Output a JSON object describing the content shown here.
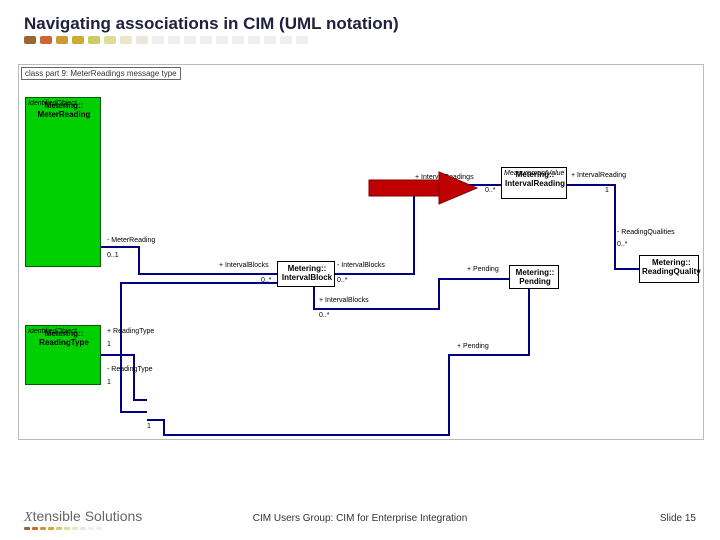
{
  "title": "Navigating associations in CIM (UML notation)",
  "dash_colors": [
    "#996633",
    "#cc6633",
    "#cc9933",
    "#ccaa33",
    "#cccc66",
    "#dddd99",
    "#e8e8c8",
    "#e8e8dd",
    "#eeeeee",
    "#eeeeee",
    "#eeeeee",
    "#eeeeee",
    "#eeeeee",
    "#eeeeee",
    "#eeeeee",
    "#eeeeee",
    "#eeeeee",
    "#eeeeee"
  ],
  "pkg_label": "class part 9: MeterReadings message type",
  "classes": {
    "meterReading": {
      "stereo": "IdentifiedObject",
      "name": "Metering::\nMeterReading"
    },
    "readingType": {
      "stereo": "IdentifiedObject",
      "name": "Metering::\nReadingType"
    },
    "intervalBlock": {
      "name": "Metering::\nIntervalBlock"
    },
    "intervalReading": {
      "stereo": "MeasurementValue",
      "name": "Metering::\nIntervalReading"
    },
    "pending": {
      "name": "Metering::\nPending"
    },
    "readingQuality": {
      "name": "Metering::\nReadingQuality"
    }
  },
  "roles": {
    "meterReading_out": "- MeterReading",
    "meterReading_mult": "0..1",
    "intervalBlocks_plus": "+ IntervalBlocks",
    "intervalBlocks_minus": "- IntervalBlocks",
    "zero_star": "0..*",
    "intervalReadings_plus": "+ IntervalReadings",
    "pending_plus": "+ Pending",
    "intervalReading_plus": "+ IntervalReading",
    "one": "1",
    "readingQualities_minus": "- ReadingQualities",
    "readingType_plus": "+ ReadingType",
    "readingType_minus": "- ReadingType",
    "intervalBlock_plus": "+ IntervalBlocks"
  },
  "footer": {
    "logo": "Xtensible Solutions",
    "center": "CIM Users Group: CIM for Enterprise Integration",
    "slide": "Slide 15"
  },
  "chart_data": {
    "type": "table",
    "description": "UML class diagram — CIM Metering associations",
    "classes": [
      {
        "name": "Metering::MeterReading",
        "stereotype": "IdentifiedObject"
      },
      {
        "name": "Metering::ReadingType",
        "stereotype": "IdentifiedObject"
      },
      {
        "name": "Metering::IntervalBlock"
      },
      {
        "name": "Metering::IntervalReading",
        "stereotype": "MeasurementValue"
      },
      {
        "name": "Metering::Pending"
      },
      {
        "name": "Metering::ReadingQuality"
      }
    ],
    "associations": [
      {
        "from": "MeterReading",
        "to": "IntervalBlock",
        "from_role": "- MeterReading",
        "from_mult": "0..1",
        "to_role": "+ IntervalBlocks",
        "to_mult": "0..*"
      },
      {
        "from": "IntervalBlock",
        "to": "IntervalReading",
        "from_role": "- IntervalBlocks",
        "from_mult": "0..*",
        "to_role": "+ IntervalReadings",
        "to_mult": "0..*"
      },
      {
        "from": "IntervalBlock",
        "to": "Pending",
        "from_role": "+ IntervalBlocks",
        "from_mult": "0..*",
        "to_role": "+ Pending"
      },
      {
        "from": "IntervalReading",
        "to": "ReadingQuality",
        "from_role": "+ IntervalReading",
        "from_mult": "1",
        "to_role": "- ReadingQualities",
        "to_mult": "0..*"
      },
      {
        "from": "ReadingType",
        "to": "MeterReading",
        "from_role": "+ ReadingType",
        "from_mult": "1"
      },
      {
        "from": "ReadingType",
        "to": "IntervalBlock",
        "from_role": "- ReadingType",
        "from_mult": "1"
      },
      {
        "from": "ReadingType",
        "to": "Pending",
        "to_role": "+ Pending",
        "from_mult": "1"
      }
    ],
    "highlight": "Red arrow points IntervalBlock → IntervalReading"
  }
}
